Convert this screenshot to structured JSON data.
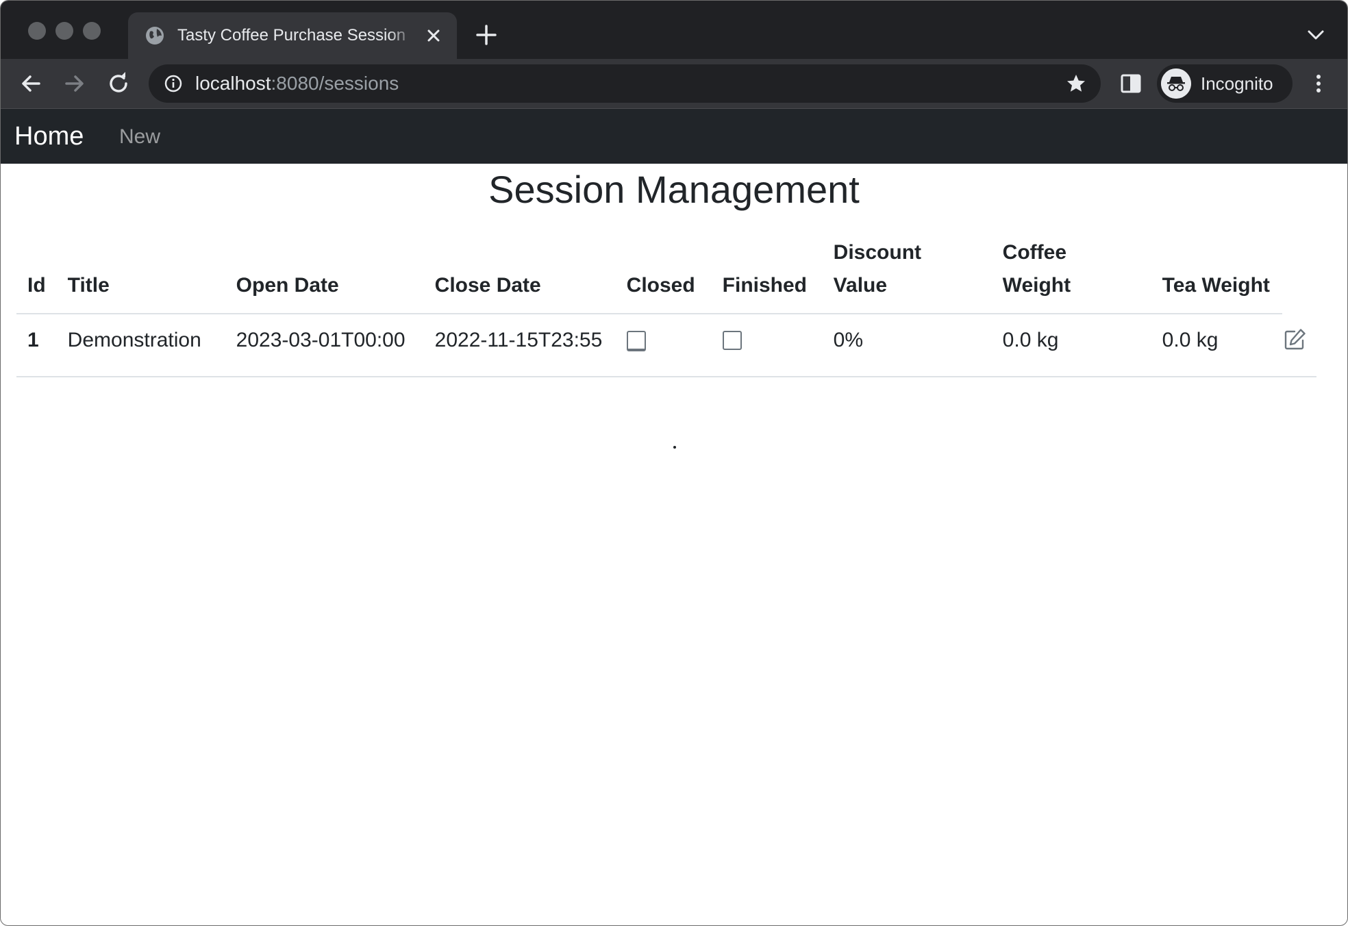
{
  "browser": {
    "tab_title": "Tasty Coffee Purchase Session",
    "url_host": "localhost",
    "url_rest": ":8080/sessions",
    "profile_label": "Incognito"
  },
  "navbar": {
    "brand": "Home",
    "links": [
      "New"
    ]
  },
  "page": {
    "title": "Session Management"
  },
  "table": {
    "headers": [
      "Id",
      "Title",
      "Open Date",
      "Close Date",
      "Closed",
      "Finished",
      "Discount Value",
      "Coffee Weight",
      "Tea Weight"
    ],
    "rows": [
      {
        "id": "1",
        "title": "Demonstration",
        "open_date": "2023-03-01T00:00",
        "close_date": "2022-11-15T23:55",
        "closed": false,
        "finished": false,
        "discount_value": "0%",
        "coffee_weight": "0.0 kg",
        "tea_weight": "0.0 kg"
      }
    ]
  },
  "footer": {
    "text": "."
  },
  "colors": {
    "navbar_bg": "#212529",
    "chrome_dark": "#202124",
    "chrome_toolbar": "#35363a",
    "text": "#212529",
    "muted": "#6c757d"
  }
}
